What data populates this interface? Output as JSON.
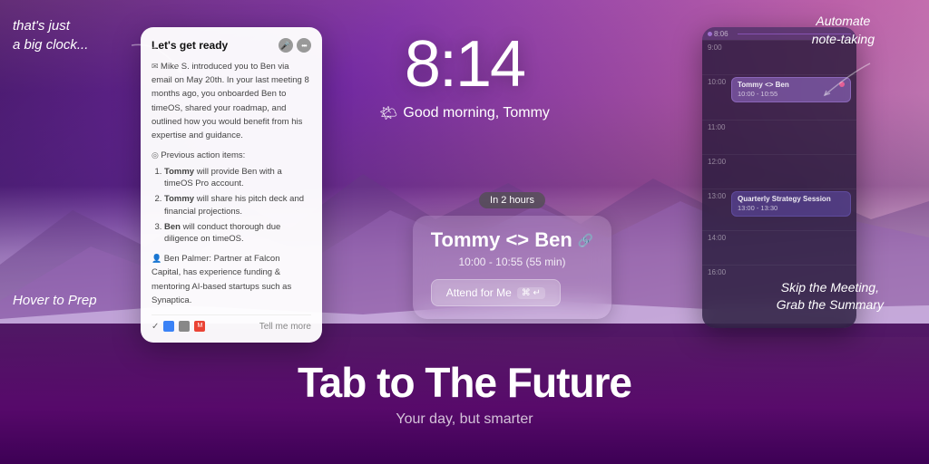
{
  "background": {
    "gradient": "mountains with pink/purple sky"
  },
  "annotations": {
    "top_left": "that's just\na big clock...",
    "bottom_left": "Hover to Prep",
    "top_right": "Automate\nnote-taking",
    "bottom_right": "Skip the Meeting,\nGrab the Summary"
  },
  "clock": {
    "time": "8:14",
    "greeting": "Good morning, Tommy",
    "sun_emoji": "🌤"
  },
  "prep_card": {
    "title": "Let's get ready",
    "mic_icon": "🎤",
    "ellipsis_icon": "•••",
    "intro_text": "Mike S. introduced you to Ben via email on May 20th. In your last meeting 8 months ago, you onboarded Ben to timeOS, shared your roadmap, and outlined how you would benefit from his expertise and guidance.",
    "previous_actions_label": "Previous action items:",
    "actions": [
      {
        "person": "Tommy",
        "action": "will provide Ben with a timeOS Pro account."
      },
      {
        "person": "Tommy",
        "action": "will share his pitch deck and financial projections."
      },
      {
        "person": "Ben",
        "action": "will conduct thorough due diligence on timeOS."
      }
    ],
    "contact": "Ben Palmer: Partner at Falcon Capital, has experience funding & mentoring AI-based startups such as Synaptica.",
    "footer_icons": [
      "✓",
      "📅",
      "📧",
      "M"
    ],
    "tell_more": "Tell me more"
  },
  "event_card": {
    "badge": "In 2 hours",
    "title": "Tommy <> Ben",
    "icon": "🔗",
    "time": "10:00 - 10:55 (55 min)",
    "attend_button": "Attend for Me",
    "kbd_shortcut": "⌘ ↵"
  },
  "calendar": {
    "current_time": "8:06",
    "hours": [
      {
        "label": "9:00",
        "event": null
      },
      {
        "label": "10:00",
        "event": {
          "name": "Tommy <> Ben",
          "time": "10:00 - 10:55",
          "color": "purple-light"
        }
      },
      {
        "label": "11:00",
        "event": null
      },
      {
        "label": "12:00",
        "event": null
      },
      {
        "label": "13:00",
        "event": {
          "name": "Quarterly Strategy Session",
          "time": "13:00 - 13:30",
          "color": "purple-dark"
        }
      },
      {
        "label": "14:00",
        "event": null
      },
      {
        "label": "16:00",
        "event": null
      }
    ]
  },
  "bottom": {
    "main_tagline": "Tab to The Future",
    "sub_tagline": "Your day, but smarter"
  }
}
